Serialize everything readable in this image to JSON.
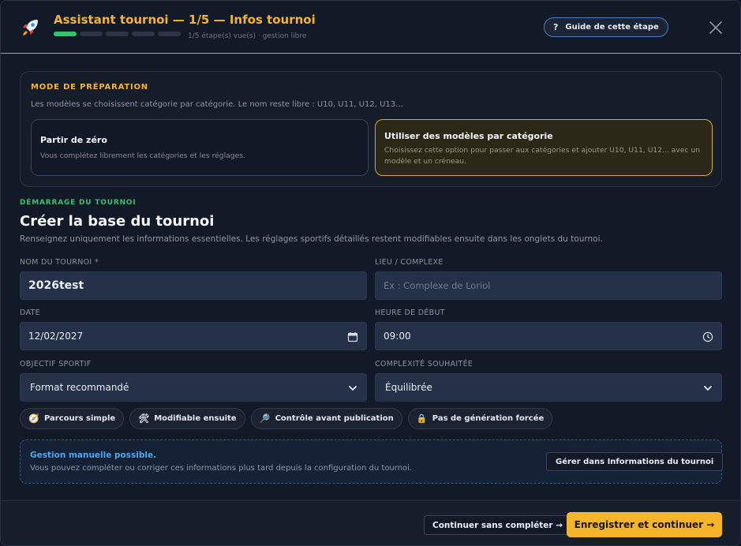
{
  "header": {
    "title": "Assistant tournoi — 1/5 — Infos tournoi",
    "progress": {
      "current_step": 1,
      "total_steps": 5
    },
    "subtitle": "1/5 étape(s) vue(s) · gestion libre",
    "guide_button": {
      "icon": "?",
      "label": "Guide de cette étape"
    },
    "icons": {
      "logo": "rocket-icon",
      "close": "close-icon"
    }
  },
  "mode": {
    "title": "MODE DE PRÉPARATION",
    "description": "Les modèles se choisissent catégorie par catégorie. Le nom reste libre : U10, U11, U12, U13…",
    "options": [
      {
        "title": "Partir de zéro",
        "description": "Vous complétez librement les catégories et les réglages.",
        "selected": false
      },
      {
        "title": "Utiliser des modèles par catégorie",
        "description": "Choisissez cette option pour passer aux catégories et ajouter U10, U11, U12... avec un modèle et un créneau.",
        "selected": true
      }
    ]
  },
  "section": {
    "kicker": "DÉMARRAGE DU TOURNOI",
    "title": "Créer la base du tournoi",
    "description": "Renseignez uniquement les informations essentielles. Les réglages sportifs détaillés restent modifiables ensuite dans les onglets du tournoi."
  },
  "form": {
    "name": {
      "label": "NOM DU TOURNOI *",
      "value": "2026test"
    },
    "location": {
      "label": "LIEU / COMPLEXE",
      "placeholder": "Ex : Complexe de Loriol"
    },
    "date": {
      "label": "DATE",
      "value": "12/02/2027"
    },
    "start_time": {
      "label": "HEURE DE DÉBUT",
      "value": "09:00"
    },
    "objective": {
      "label": "OBJECTIF SPORTIF",
      "value": "Format recommandé"
    },
    "complexity": {
      "label": "COMPLEXITÉ SOUHAITÉE",
      "value": "Équilibrée"
    }
  },
  "chips": [
    {
      "icon": "🧭",
      "label": "Parcours simple"
    },
    {
      "icon": "🛠",
      "label": "Modifiable ensuite"
    },
    {
      "icon": "🔎",
      "label": "Contrôle avant publication"
    },
    {
      "icon": "🔒",
      "label": "Pas de génération forcée"
    }
  ],
  "manual": {
    "title": "Gestion manuelle possible.",
    "description": "Vous pouvez compléter ou corriger ces informations plus tard depuis la configuration du tournoi.",
    "button": "Gérer dans Informations du tournoi"
  },
  "footer": {
    "skip": "Continuer sans compléter →",
    "save": "Enregistrer et continuer →"
  },
  "colors": {
    "accent": "#f5b52a",
    "success": "#35c46a",
    "info": "#4ea6f0",
    "background": "#131a27"
  }
}
